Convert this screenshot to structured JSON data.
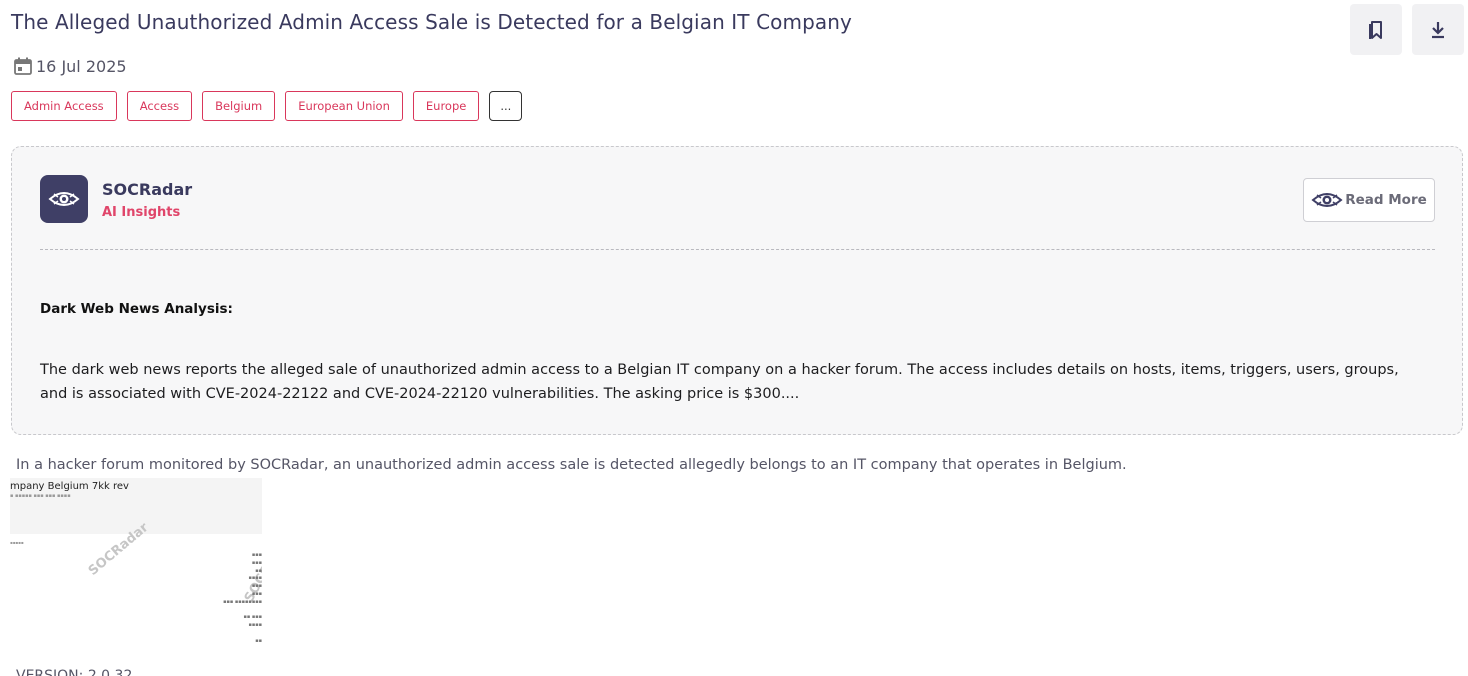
{
  "header": {
    "title": "The Alleged Unauthorized Admin Access Sale is Detected for a Belgian IT Company",
    "date": "16 Jul 2025"
  },
  "tags": [
    "Admin Access",
    "Access",
    "Belgium",
    "European Union",
    "Europe"
  ],
  "tags_more_label": "...",
  "insights": {
    "brand_name": "SOCRadar",
    "brand_subtitle": "AI Insights",
    "read_more_label": "Read More",
    "heading": "Dark Web News Analysis:",
    "text": "The dark web news reports the alleged sale of unauthorized admin access to a Belgian IT company on a hacker forum. The access includes details on hosts, items, triggers, users, groups, and is associated with CVE-2024-22122 and CVE-2024-22120 vulnerabilities. The asking price is $300...."
  },
  "summary": "In a hacker forum monitored by SOCRadar, an unauthorized admin access sale is detected allegedly belongs to an IT company that operates in Belgium.",
  "screenshot": {
    "title": "mpany Belgium 7kk rev",
    "watermark": "SOCRadar"
  },
  "footer": {
    "version": "VERSION: 2.0.32"
  },
  "icons": {
    "bookmark": "bookmark-icon",
    "download": "download-icon",
    "calendar": "calendar-icon",
    "brand": "socradar-eye-icon"
  },
  "colors": {
    "accent": "#d9375b",
    "brand_dark": "#3f3f66",
    "ai_insights": "#e0456a"
  }
}
